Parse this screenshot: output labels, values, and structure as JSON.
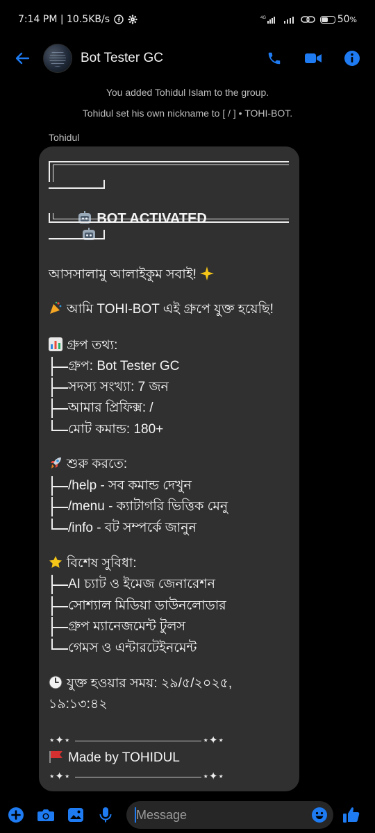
{
  "status_bar": {
    "time_speed": "7:14 PM | 10.5KB/s",
    "network": "4G",
    "battery": "50",
    "battery_unit": "%",
    "battery_level": 0.5
  },
  "header": {
    "title": "Bot Tester GC",
    "accent": "#1e7bf2"
  },
  "system_messages": [
    "You added Tohidul Islam to the group.",
    "Tohidul set his own nickname to [ / ] • TOHI-BOT."
  ],
  "sender": "Tohidul",
  "message": {
    "bot_title": "BOT ACTIVATED",
    "greeting": "আসসালামু আলাইকুম সবাই!",
    "joined": "আমি TOHI-BOT এই গ্রুপে যুক্ত হয়েছি!",
    "group_info_heading": "গ্রুপ তথ্য:",
    "group_info": [
      "গ্রুপ: Bot Tester GC",
      "সদস্য সংখ্যা: 7 জন",
      "আমার প্রিফিক্স: /",
      "মোট কমান্ড: 180+"
    ],
    "start_heading": "শুরু করতে:",
    "start_items": [
      "/help - সব কমান্ড দেখুন",
      "/menu - ক্যাটাগরি ভিত্তিক মেনু",
      "/info - বট সম্পর্কে জানুন"
    ],
    "features_heading": "বিশেষ সুবিধা:",
    "features": [
      "AI চ্যাট ও ইমেজ জেনারেশন",
      "সোশ্যাল মিডিয়া ডাউনলোডার",
      "গ্রুপ ম্যানেজমেন্ট টুলস",
      "গেমস ও এন্টারটেইনমেন্ট"
    ],
    "joined_time_line1": "যুক্ত হওয়ার সময়: ২৯/৫/২০২৫,",
    "joined_time_line2": "১৯:১৩:৪২",
    "credit": "Made by TOHIDUL"
  },
  "composer": {
    "placeholder": "Message"
  }
}
